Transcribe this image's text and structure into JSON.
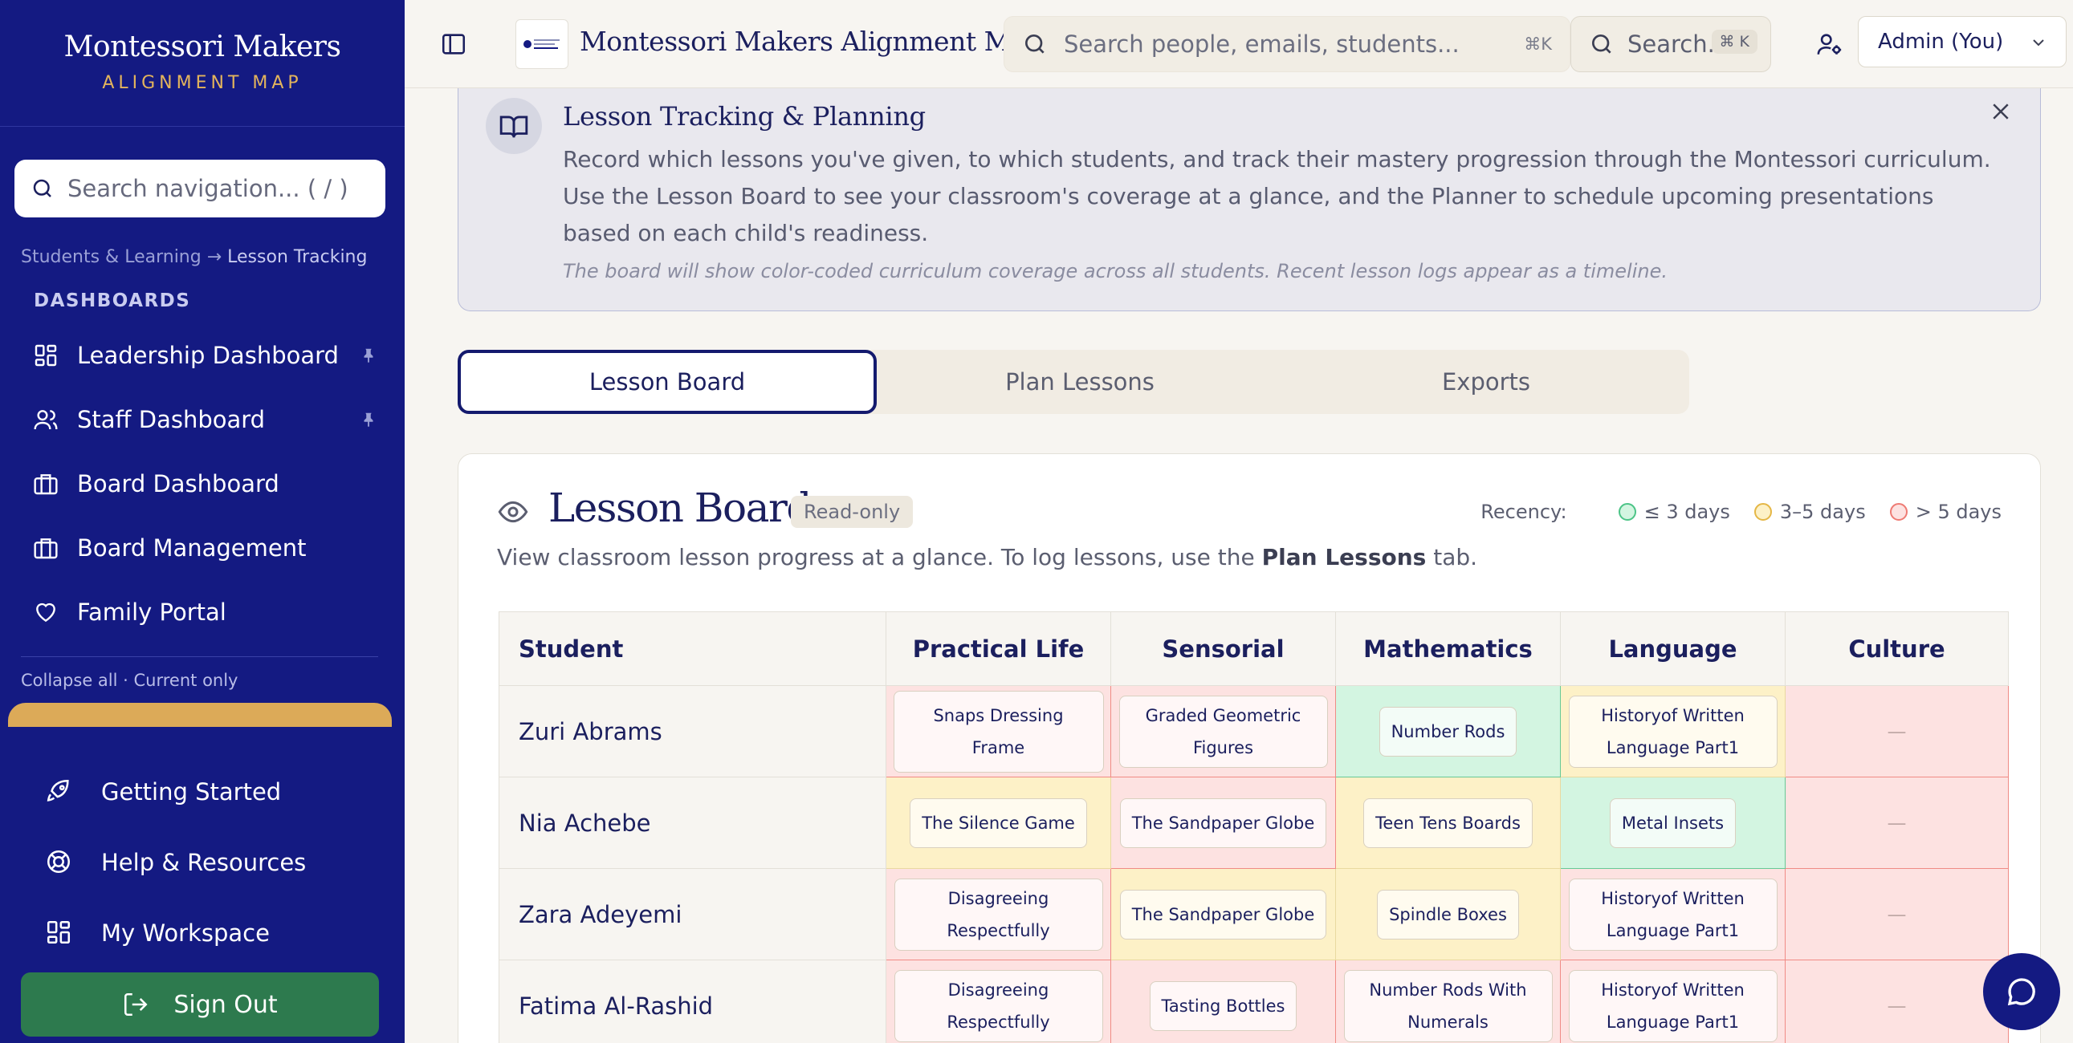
{
  "brand": {
    "title": "Montessori Makers",
    "subtitle": "ALIGNMENT MAP"
  },
  "nav_search": {
    "placeholder": "Search navigation... ( / )"
  },
  "breadcrumb": {
    "parent": "Students & Learning",
    "arrow": "→",
    "current": "Lesson Tracking"
  },
  "sidebar": {
    "section": "DASHBOARDS",
    "items": [
      {
        "label": "Leadership Dashboard",
        "icon": "grid-icon",
        "pinned": true
      },
      {
        "label": "Staff Dashboard",
        "icon": "users-icon",
        "pinned": true
      },
      {
        "label": "Board Dashboard",
        "icon": "briefcase-icon",
        "pinned": false
      },
      {
        "label": "Board Management",
        "icon": "briefcase-icon",
        "pinned": false
      },
      {
        "label": "Family Portal",
        "icon": "heart-icon",
        "pinned": false
      }
    ],
    "collapse_all": "Collapse all",
    "separator": "·",
    "current_only": "Current only",
    "bottom": [
      {
        "label": "Getting Started",
        "icon": "rocket-icon"
      },
      {
        "label": "Help & Resources",
        "icon": "lifebuoy-icon"
      },
      {
        "label": "My Workspace",
        "icon": "grid-icon"
      }
    ],
    "sign_out": "Sign Out"
  },
  "topbar": {
    "app_title": "Montessori Makers Alignment Map",
    "search_placeholder": "Search people, emails, students...",
    "search_shortcut": "⌘K",
    "search2_label": "Search...",
    "search2_shortcut": "⌘ K",
    "user_menu": "Admin (You)"
  },
  "info": {
    "title": "Lesson Tracking & Planning",
    "body": "Record which lessons you've given, to which students, and track their mastery progression through the Montessori curriculum. Use the Lesson Board to see your classroom's coverage at a glance, and the Planner to schedule upcoming presentations based on each child's readiness.",
    "note": "The board will show color-coded curriculum coverage across all students. Recent lesson logs appear as a timeline."
  },
  "tabs": [
    "Lesson Board",
    "Plan Lessons",
    "Exports"
  ],
  "board": {
    "title": "Lesson Board",
    "badge": "Read-only",
    "subtitle_pre": "View classroom lesson progress at a glance. To log lessons, use the ",
    "subtitle_bold": "Plan Lessons",
    "subtitle_post": " tab.",
    "recency_label": "Recency:",
    "legend": [
      {
        "label": "≤ 3 days",
        "fill": "#d3f5e1",
        "stroke": "#4cc487"
      },
      {
        "label": "3–5 days",
        "fill": "#fdf1c7",
        "stroke": "#e5b746"
      },
      {
        "label": "> 5 days",
        "fill": "#fde2e1",
        "stroke": "#ee7b74"
      }
    ],
    "columns": [
      "Student",
      "Practical Life",
      "Sensorial",
      "Mathematics",
      "Language",
      "Culture"
    ],
    "rows": [
      {
        "student": "Zuri Abrams",
        "cells": [
          {
            "text": "Snaps Dressing Frame",
            "status": "r"
          },
          {
            "text": "Graded Geometric Figures",
            "status": "r"
          },
          {
            "text": "Number Rods",
            "status": "g"
          },
          {
            "text": "Historyof Written Language Part1",
            "status": "y"
          },
          {
            "text": "—",
            "status": "r"
          }
        ]
      },
      {
        "student": "Nia Achebe",
        "cells": [
          {
            "text": "The Silence Game",
            "status": "y"
          },
          {
            "text": "The Sandpaper Globe",
            "status": "r"
          },
          {
            "text": "Teen Tens Boards",
            "status": "y"
          },
          {
            "text": "Metal Insets",
            "status": "g"
          },
          {
            "text": "—",
            "status": "r"
          }
        ]
      },
      {
        "student": "Zara Adeyemi",
        "cells": [
          {
            "text": "Disagreeing Respectfully",
            "status": "r"
          },
          {
            "text": "The Sandpaper Globe",
            "status": "y"
          },
          {
            "text": "Spindle Boxes",
            "status": "y"
          },
          {
            "text": "Historyof Written Language Part1",
            "status": "r"
          },
          {
            "text": "—",
            "status": "r"
          }
        ]
      },
      {
        "student": "Fatima Al-Rashid",
        "cells": [
          {
            "text": "Disagreeing Respectfully",
            "status": "r"
          },
          {
            "text": "Tasting Bottles",
            "status": "r"
          },
          {
            "text": "Number Rods With Numerals",
            "status": "r"
          },
          {
            "text": "Historyof Written Language Part1",
            "status": "r"
          },
          {
            "text": "—",
            "status": "r"
          }
        ]
      }
    ]
  },
  "colors": {
    "sidebar": "#141a82",
    "accent_gold": "#dcaa58",
    "sign_out": "#2d7a4e",
    "ink": "#1b1f5e"
  }
}
